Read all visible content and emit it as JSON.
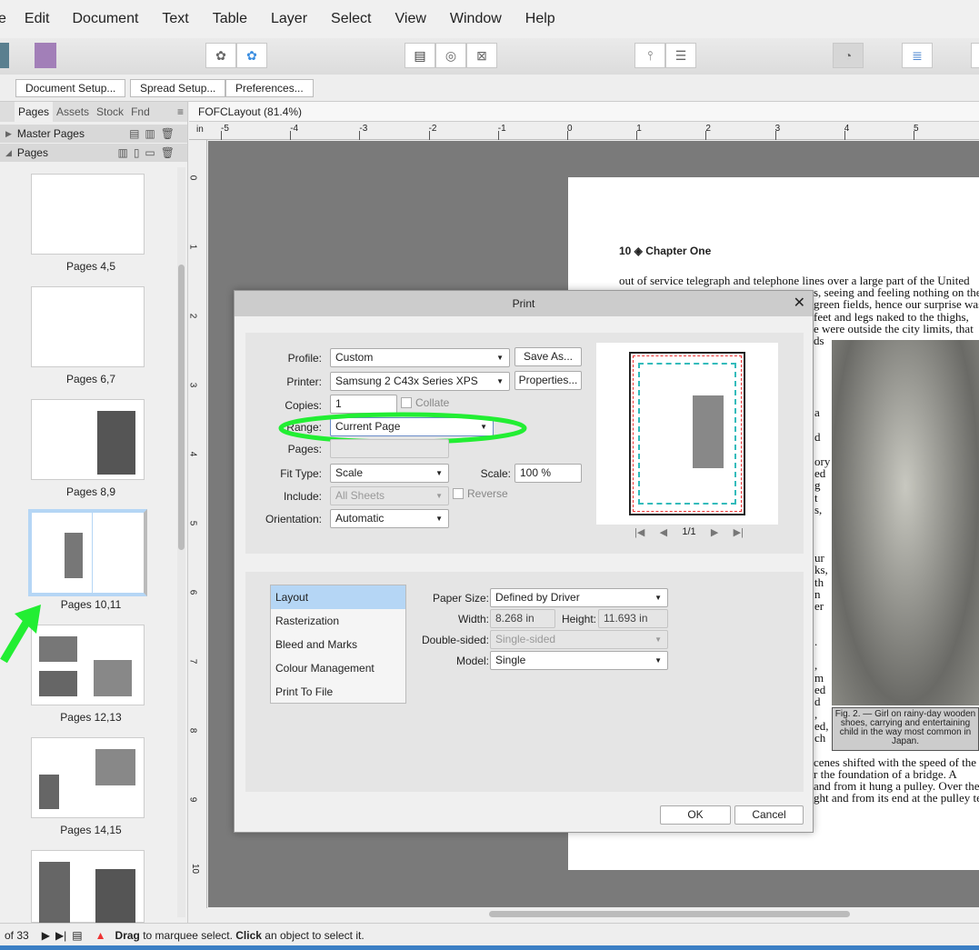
{
  "menu": [
    "e",
    "Edit",
    "Document",
    "Text",
    "Table",
    "Layer",
    "Select",
    "View",
    "Window",
    "Help"
  ],
  "context_buttons": [
    "Document Setup...",
    "Spread Setup...",
    "Preferences..."
  ],
  "panel": {
    "tabs": [
      "Pages",
      "Assets",
      "Stock",
      "Fnd"
    ],
    "master_pages": "Master Pages",
    "pages": "Pages",
    "thumbnails": [
      "Pages 4,5",
      "Pages 6,7",
      "Pages 8,9",
      "Pages 10,11",
      "Pages 12,13",
      "Pages 14,15"
    ],
    "selected": "Pages 10,11"
  },
  "document_tab": "FOFCLayout (81.4%)",
  "ruler": {
    "unit": "in",
    "h_ticks": [
      "-5",
      "-4",
      "-3",
      "-2",
      "-1",
      "0",
      "1",
      "2",
      "3",
      "4",
      "5"
    ],
    "v_ticks": [
      "0",
      "1",
      "2",
      "3",
      "4",
      "5",
      "6",
      "7",
      "8",
      "9",
      "10"
    ]
  },
  "page": {
    "header": "10 ◈ Chapter One",
    "lines": [
      "out of service telegraph and telephone lines over a large part of the United",
      "s, seeing and feeling nothing on the",
      "green fields, hence our surprise was",
      "feet and legs naked to the thighs,",
      "e were outside the city limits, that",
      "ds"
    ],
    "fragments": [
      "a",
      "d",
      "ory",
      "ed",
      "g",
      "t",
      "s,",
      "ur",
      "ks,",
      "th",
      "n",
      "er",
      ".",
      ",",
      "m",
      "ed",
      "d",
      ",",
      "ed,",
      "ch"
    ],
    "bottom_lines": [
      "cenes shifted with the speed of the",
      "r the foundation of a bridge. A",
      "and from it hung a pulley. Over the",
      "ght and from its end at the pulley ter"
    ],
    "caption": "Fig. 2. — Girl on rainy-day wooden shoes, carrying and entertaining child in the way most common in Japan."
  },
  "dialog": {
    "title": "Print",
    "profile_label": "Profile:",
    "profile": "Custom",
    "save_as": "Save As...",
    "printer_label": "Printer:",
    "printer": "Samsung 2 C43x Series XPS",
    "properties": "Properties...",
    "copies_label": "Copies:",
    "copies": "1",
    "collate": "Collate",
    "range_label": "Range:",
    "range": "Current Page",
    "pages_label": "Pages:",
    "pages": "",
    "fit_label": "Fit Type:",
    "fit": "Scale",
    "scale_label": "Scale:",
    "scale": "100 %",
    "include_label": "Include:",
    "include": "All Sheets",
    "reverse": "Reverse",
    "orientation_label": "Orientation:",
    "orientation": "Automatic",
    "preview_page": "1/1",
    "categories": [
      "Layout",
      "Rasterization",
      "Bleed and Marks",
      "Colour Management",
      "Print To File"
    ],
    "selected_category": "Layout",
    "paper_size_label": "Paper Size:",
    "paper_size": "Defined by Driver",
    "width_label": "Width:",
    "width": "8.268 in",
    "height_label": "Height:",
    "height": "11.693 in",
    "double_label": "Double-sided:",
    "double": "Single-sided",
    "model_label": "Model:",
    "model": "Single",
    "ok": "OK",
    "cancel": "Cancel"
  },
  "status": {
    "page_count": "of 33",
    "hint_bold1": "Drag",
    "hint1": " to marquee select. ",
    "hint_bold2": "Click",
    "hint2": " an object to select it."
  },
  "colors": {
    "annotation": "#22ee33",
    "selection": "#b5d6f5",
    "canvas": "#7a7a7a"
  }
}
